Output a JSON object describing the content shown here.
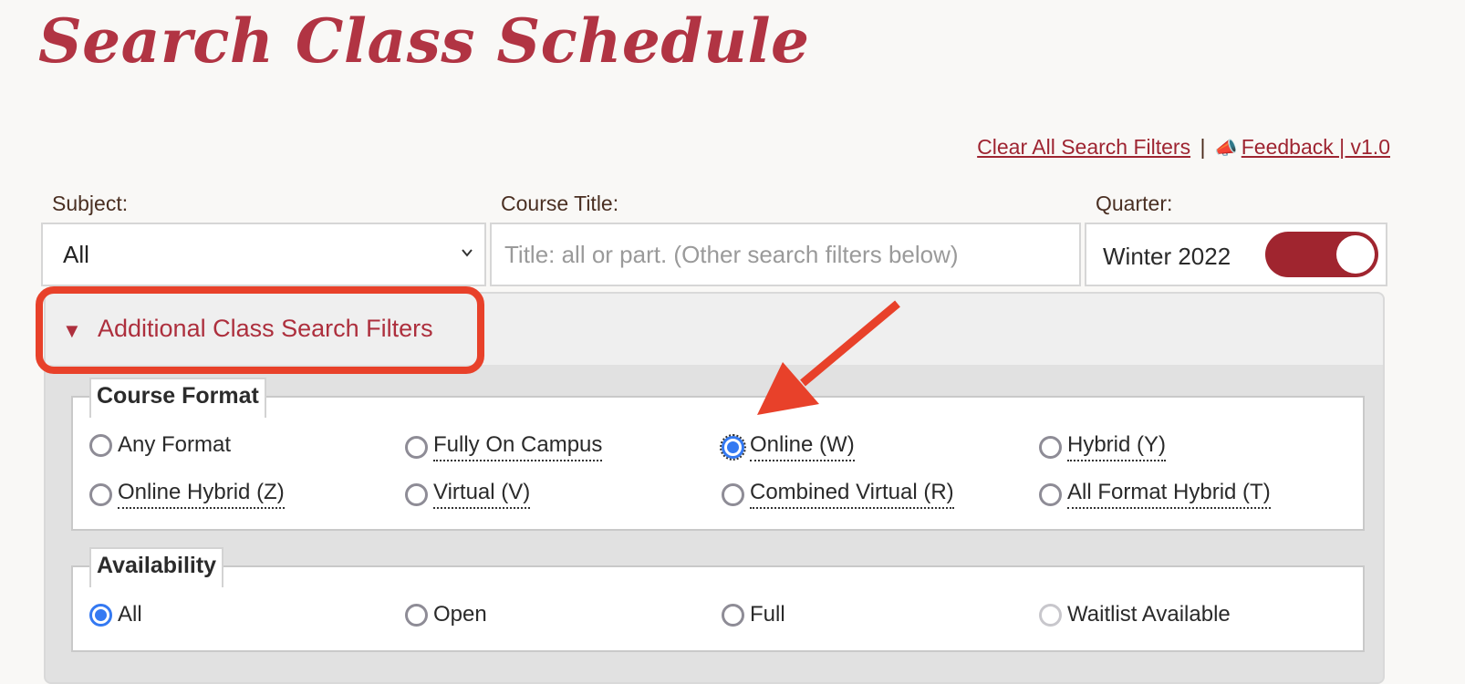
{
  "page": {
    "title": "Search Class Schedule"
  },
  "top_links": {
    "clear_filters": "Clear All Search Filters",
    "separator": "|",
    "feedback_icon": "megaphone-icon",
    "feedback_glyph": "📣",
    "feedback": "Feedback | v1.0"
  },
  "subject": {
    "label": "Subject:",
    "value": "All"
  },
  "course_title": {
    "label": "Course Title:",
    "placeholder": "Title: all or part. (Other search filters below)",
    "value": ""
  },
  "quarter": {
    "label": "Quarter:",
    "value": "Winter 2022",
    "toggle_on": true
  },
  "additional_filters": {
    "label": "Additional Class Search Filters",
    "expanded": true,
    "toggle_glyph": "▼"
  },
  "course_format": {
    "legend": "Course Format",
    "options": [
      {
        "label": "Any Format",
        "checked": false,
        "tooltip": false
      },
      {
        "label": "Fully On Campus",
        "checked": false,
        "tooltip": true
      },
      {
        "label": "Online (W)",
        "checked": true,
        "tooltip": true
      },
      {
        "label": "Hybrid (Y)",
        "checked": false,
        "tooltip": true
      },
      {
        "label": "Online Hybrid (Z)",
        "checked": false,
        "tooltip": true
      },
      {
        "label": "Virtual (V)",
        "checked": false,
        "tooltip": true
      },
      {
        "label": "Combined Virtual (R)",
        "checked": false,
        "tooltip": true
      },
      {
        "label": "All Format Hybrid (T)",
        "checked": false,
        "tooltip": true
      }
    ]
  },
  "availability": {
    "legend": "Availability",
    "options": [
      {
        "label": "All",
        "checked": true
      },
      {
        "label": "Open",
        "checked": false
      },
      {
        "label": "Full",
        "checked": false
      },
      {
        "label": "Waitlist Available",
        "checked": false,
        "disabled": true
      }
    ]
  },
  "colors": {
    "brand": "#b13443",
    "toggle": "#a0252f",
    "radio_checked": "#3479f2",
    "annotation": "#e8412a"
  }
}
